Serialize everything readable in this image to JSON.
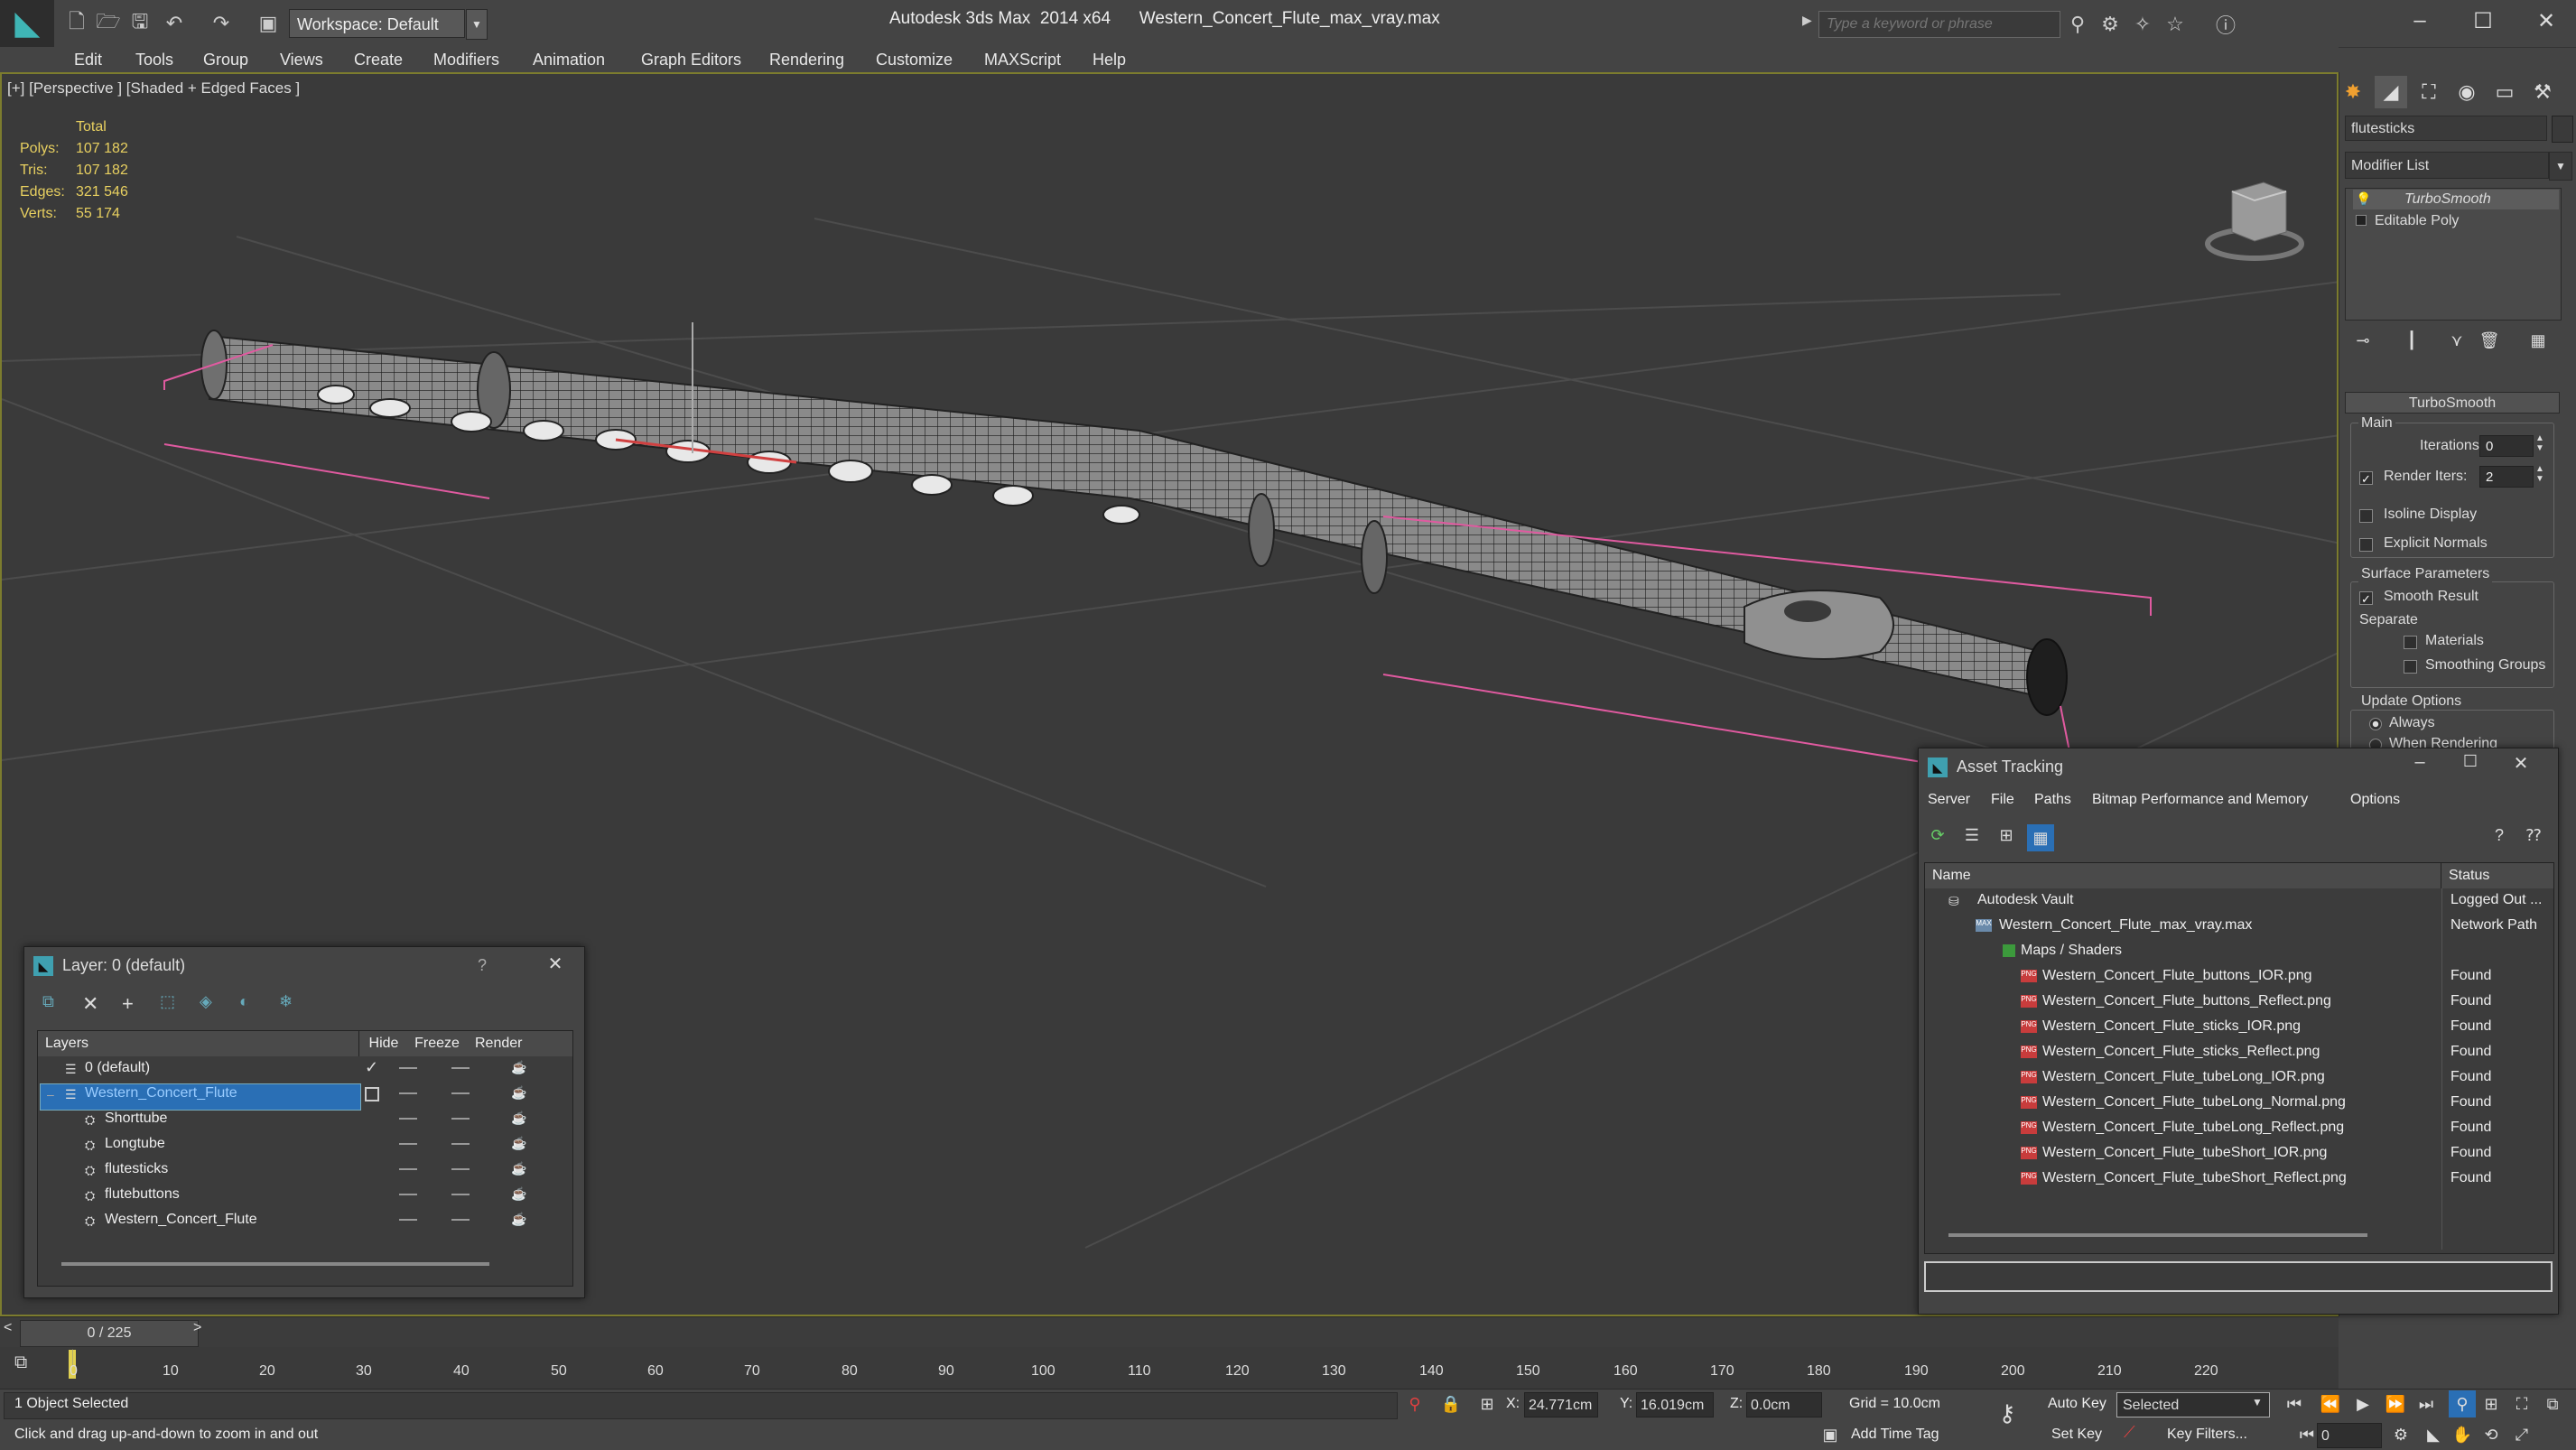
{
  "title_bar": {
    "workspace": "Workspace: Default",
    "app_title": "Autodesk 3ds Max  2014 x64",
    "file_title": "Western_Concert_Flute_max_vray.max",
    "search_placeholder": "Type a keyword or phrase"
  },
  "menu": [
    "Edit",
    "Tools",
    "Group",
    "Views",
    "Create",
    "Modifiers",
    "Animation",
    "Graph Editors",
    "Rendering",
    "Customize",
    "MAXScript",
    "Help"
  ],
  "viewport": {
    "label": "[+] [Perspective ] [Shaded + Edged Faces ]",
    "stats": {
      "header": "Total",
      "rows": [
        {
          "label": "Polys:",
          "value": "107 182"
        },
        {
          "label": "Tris:",
          "value": "107 182"
        },
        {
          "label": "Edges:",
          "value": "321 546"
        },
        {
          "label": "Verts:",
          "value": "55 174"
        }
      ]
    }
  },
  "command_panel": {
    "object_name": "flutesticks",
    "modifier_list": "Modifier List",
    "stack": [
      "TurboSmooth",
      "Editable Poly"
    ],
    "rollout_title": "TurboSmooth",
    "main_label": "Main",
    "iterations_label": "Iterations:",
    "iterations_value": "0",
    "render_iters_label": "Render Iters:",
    "render_iters_value": "2",
    "isoline_label": "Isoline Display",
    "explicit_normals_label": "Explicit Normals",
    "surface_params_label": "Surface Parameters",
    "smooth_result_label": "Smooth Result",
    "separate_label": "Separate",
    "materials_label": "Materials",
    "smoothing_groups_label": "Smoothing Groups",
    "update_options_label": "Update Options",
    "always_label": "Always",
    "when_rendering_label": "When Rendering"
  },
  "layer_window": {
    "title": "Layer: 0 (default)",
    "help": "?",
    "columns": [
      "Layers",
      "Hide",
      "Freeze",
      "Render"
    ],
    "rows": [
      {
        "name": "0 (default)"
      },
      {
        "name": "Western_Concert_Flute"
      },
      {
        "name": "Shorttube"
      },
      {
        "name": "Longtube"
      },
      {
        "name": "flutesticks"
      },
      {
        "name": "flutebuttons"
      },
      {
        "name": "Western_Concert_Flute"
      }
    ]
  },
  "asset_window": {
    "title": "Asset Tracking",
    "menu": [
      "Server",
      "File",
      "Paths",
      "Bitmap Performance and Memory",
      "Options"
    ],
    "columns": [
      "Name",
      "Status"
    ],
    "rows": [
      {
        "name": "Autodesk Vault",
        "status": "Logged Out ..."
      },
      {
        "name": "Western_Concert_Flute_max_vray.max",
        "status": "Network Path"
      },
      {
        "name": "Maps / Shaders",
        "status": ""
      },
      {
        "name": "Western_Concert_Flute_buttons_IOR.png",
        "status": "Found"
      },
      {
        "name": "Western_Concert_Flute_buttons_Reflect.png",
        "status": "Found"
      },
      {
        "name": "Western_Concert_Flute_sticks_IOR.png",
        "status": "Found"
      },
      {
        "name": "Western_Concert_Flute_sticks_Reflect.png",
        "status": "Found"
      },
      {
        "name": "Western_Concert_Flute_tubeLong_IOR.png",
        "status": "Found"
      },
      {
        "name": "Western_Concert_Flute_tubeLong_Normal.png",
        "status": "Found"
      },
      {
        "name": "Western_Concert_Flute_tubeLong_Reflect.png",
        "status": "Found"
      },
      {
        "name": "Western_Concert_Flute_tubeShort_IOR.png",
        "status": "Found"
      },
      {
        "name": "Western_Concert_Flute_tubeShort_Reflect.png",
        "status": "Found"
      }
    ]
  },
  "timeline": {
    "frame": "0 / 225",
    "ticks": [
      "0",
      "10",
      "20",
      "30",
      "40",
      "50",
      "60",
      "70",
      "80",
      "90",
      "100",
      "110",
      "120",
      "130",
      "140",
      "150",
      "160",
      "170",
      "180",
      "190",
      "200",
      "210",
      "220"
    ]
  },
  "status": {
    "selection": "1 Object Selected",
    "prompt": "Click and drag up-and-down to zoom in and out",
    "x_label": "X:",
    "x_value": "24.771cm",
    "y_label": "Y:",
    "y_value": "16.019cm",
    "z_label": "Z:",
    "z_value": "0.0cm",
    "grid": "Grid = 10.0cm",
    "auto_key": "Auto Key",
    "set_key": "Set Key",
    "selected": "Selected",
    "key_filters": "Key Filters...",
    "add_time_tag": "Add Time Tag",
    "frame_value": "0"
  }
}
